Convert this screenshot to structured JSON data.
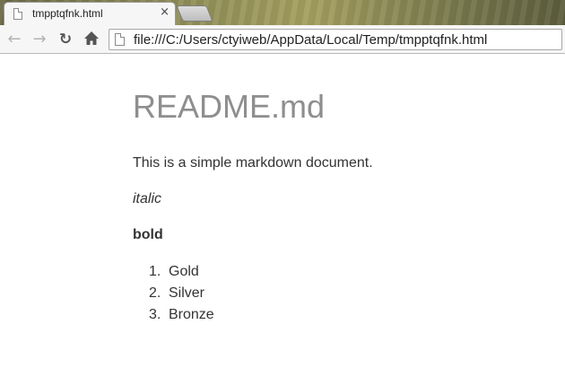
{
  "browser": {
    "tab": {
      "title": "tmpptqfnk.html",
      "close_glyph": "×"
    },
    "toolbar": {
      "back_glyph": "←",
      "forward_glyph": "→",
      "reload_glyph": "↻"
    },
    "address_bar": {
      "url": "file:///C:/Users/ctyiweb/AppData/Local/Temp/tmpptqfnk.html"
    }
  },
  "document": {
    "title": "README.md",
    "paragraph": "This is a simple markdown document.",
    "italic_text": "italic",
    "bold_text": "bold",
    "ordered_list": [
      {
        "number": "1.",
        "text": "Gold"
      },
      {
        "number": "2.",
        "text": "Silver"
      },
      {
        "number": "3.",
        "text": "Bronze"
      }
    ]
  },
  "colors": {
    "title_gray": "#8e8e8e",
    "body_text": "#333333",
    "disabled_nav": "#b3b3b3"
  },
  "icons": {
    "tab": "page-icon",
    "back": "back-arrow-icon",
    "forward": "forward-arrow-icon",
    "reload": "reload-icon",
    "home": "home-icon",
    "omnibox": "page-icon"
  }
}
